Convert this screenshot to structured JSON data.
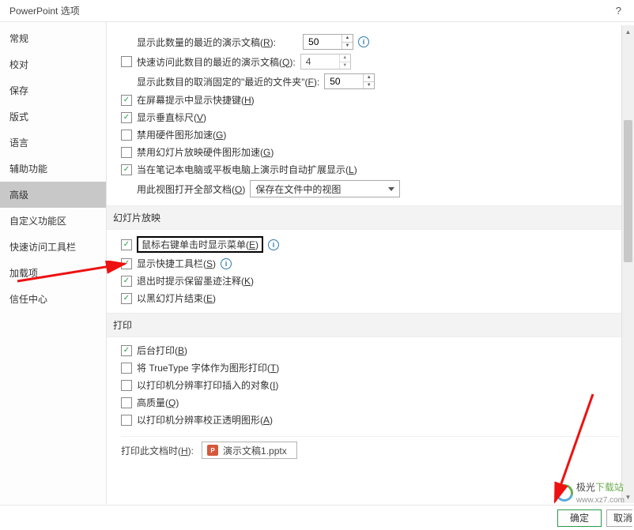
{
  "window": {
    "title": "PowerPoint 选项",
    "help": "?"
  },
  "sidebar": {
    "items": [
      {
        "label": "常规"
      },
      {
        "label": "校对"
      },
      {
        "label": "保存"
      },
      {
        "label": "版式"
      },
      {
        "label": "语言"
      },
      {
        "label": "辅助功能"
      },
      {
        "label": "高级"
      },
      {
        "label": "自定义功能区"
      },
      {
        "label": "快速访问工具栏"
      },
      {
        "label": "加载项"
      },
      {
        "label": "信任中心"
      }
    ],
    "selected_index": 6
  },
  "display_section": {
    "row1": {
      "label": "显示此数量的最近的演示文稿(",
      "accel": "R",
      "tail": "):",
      "value": "50"
    },
    "row2": {
      "label": "快速访问此数目的最近的演示文稿(",
      "accel": "Q",
      "tail": "):",
      "value": "4",
      "checked": false
    },
    "row3": {
      "label": "显示此数目的取消固定的\"最近的文件夹\"(",
      "accel": "F",
      "tail": "):",
      "value": "50"
    },
    "chk1": {
      "label": "在屏幕提示中显示快捷键(",
      "accel": "H",
      "tail": ")",
      "checked": true
    },
    "chk2": {
      "label": "显示垂直标尺(",
      "accel": "V",
      "tail": ")",
      "checked": true
    },
    "chk3": {
      "label": "禁用硬件图形加速(",
      "accel": "G",
      "tail": ")",
      "checked": false
    },
    "chk4": {
      "label": "禁用幻灯片放映硬件图形加速(",
      "accel": "G",
      "tail": ")",
      "checked": false
    },
    "chk5": {
      "label": "当在笔记本电脑或平板电脑上演示时自动扩展显示(",
      "accel": "L",
      "tail": ")",
      "checked": true
    },
    "viewrow": {
      "label": "用此视图打开全部文档(",
      "accel": "O",
      "tail": ")",
      "select_value": "保存在文件中的视图"
    }
  },
  "slideshow_section": {
    "header": "幻灯片放映",
    "chk1": {
      "label": "鼠标右键单击时显示菜单(",
      "accel": "E",
      "tail": ")",
      "checked": true
    },
    "chk2": {
      "label": "显示快捷工具栏(",
      "accel": "S",
      "tail": ")",
      "checked": true
    },
    "chk3": {
      "label": "退出时提示保留墨迹注释(",
      "accel": "K",
      "tail": ")",
      "checked": true
    },
    "chk4": {
      "label": "以黑幻灯片结束(",
      "accel": "E",
      "tail": ")",
      "checked": true
    }
  },
  "print_section": {
    "header": "打印",
    "chk1": {
      "label": "后台打印(",
      "accel": "B",
      "tail": ")",
      "checked": true
    },
    "chk2": {
      "label": "将 TrueType 字体作为图形打印(",
      "accel": "T",
      "tail": ")",
      "checked": false
    },
    "chk3": {
      "label": "以打印机分辨率打印插入的对象(",
      "accel": "I",
      "tail": ")",
      "checked": false
    },
    "chk4": {
      "label": "高质量(",
      "accel": "Q",
      "tail": ")",
      "checked": false
    },
    "chk5": {
      "label": "以打印机分辨率校正透明图形(",
      "accel": "A",
      "tail": ")",
      "checked": false
    }
  },
  "print_doc_section": {
    "header_partial": "打印此文档时(",
    "accel": "H",
    "doc_name": "演示文稿1.pptx"
  },
  "footer": {
    "ok": "确定",
    "cancel": "取消"
  },
  "watermark": {
    "text1": "极光",
    "text2": "下载站",
    "url": "www.xz7.com"
  }
}
